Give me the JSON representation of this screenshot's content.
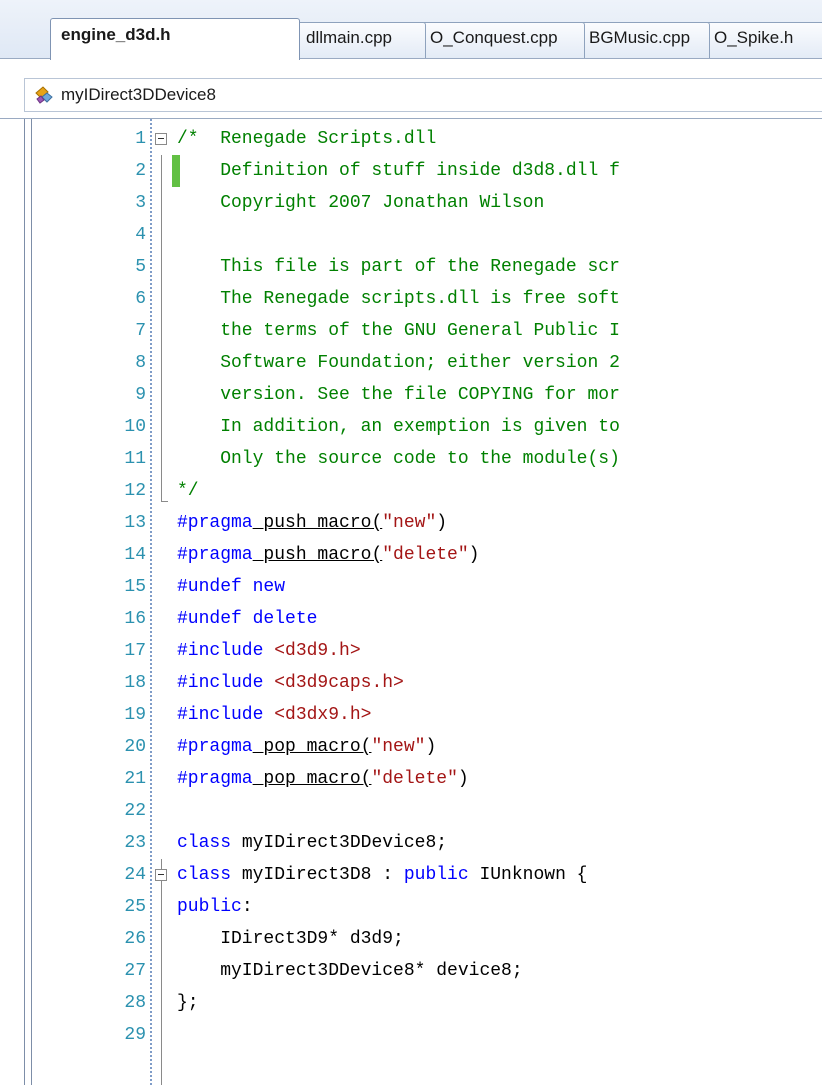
{
  "tabs": [
    {
      "label": "engine_d3d.h",
      "active": true
    },
    {
      "label": "dllmain.cpp",
      "active": false
    },
    {
      "label": "O_Conquest.cpp",
      "active": false
    },
    {
      "label": "BGMusic.cpp",
      "active": false
    },
    {
      "label": "O_Spike.h",
      "active": false
    }
  ],
  "nav": {
    "icon": "class-icon",
    "label": "myIDirect3DDevice8"
  },
  "colors": {
    "line_number": "#2b91af",
    "comment": "#008000",
    "keyword": "#0000ff",
    "string": "#a31515",
    "text": "#000000",
    "change_marker": "#62c044"
  },
  "editor": {
    "lines": [
      {
        "n": "1",
        "text": "/*  Renegade Scripts.dll"
      },
      {
        "n": "2",
        "text": "    Definition of stuff inside d3d8.dll f"
      },
      {
        "n": "3",
        "text": "    Copyright 2007 Jonathan Wilson"
      },
      {
        "n": "4",
        "text": ""
      },
      {
        "n": "5",
        "text": "    This file is part of the Renegade scr"
      },
      {
        "n": "6",
        "text": "    The Renegade scripts.dll is free soft"
      },
      {
        "n": "7",
        "text": "    the terms of the GNU General Public I"
      },
      {
        "n": "8",
        "text": "    Software Foundation; either version 2"
      },
      {
        "n": "9",
        "text": "    version. See the file COPYING for mor"
      },
      {
        "n": "10",
        "text": "    In addition, an exemption is given to"
      },
      {
        "n": "11",
        "text": "    Only the source code to the module(s)"
      },
      {
        "n": "12",
        "text": "*/"
      },
      {
        "n": "13",
        "kw": "#pragma",
        "mid": " push_macro(",
        "str": "\"new\"",
        "end": ")"
      },
      {
        "n": "14",
        "kw": "#pragma",
        "mid": " push_macro(",
        "str": "\"delete\"",
        "end": ")"
      },
      {
        "n": "15",
        "kw": "#undef",
        "kw2": " new"
      },
      {
        "n": "16",
        "kw": "#undef",
        "kw2": " delete"
      },
      {
        "n": "17",
        "kw": "#include",
        "str": " <d3d9.h>"
      },
      {
        "n": "18",
        "kw": "#include",
        "str": " <d3d9caps.h>"
      },
      {
        "n": "19",
        "kw": "#include",
        "str": " <d3dx9.h>"
      },
      {
        "n": "20",
        "kw": "#pragma",
        "mid": " pop_macro(",
        "str": "\"new\"",
        "end": ")"
      },
      {
        "n": "21",
        "kw": "#pragma",
        "mid": " pop_macro(",
        "str": "\"delete\"",
        "end": ")"
      },
      {
        "n": "22",
        "text": ""
      },
      {
        "n": "23",
        "kw": "class",
        "rest": " myIDirect3DDevice8;"
      },
      {
        "n": "24",
        "kw": "class",
        "rest": " myIDirect3D8 : ",
        "kw3": "public",
        "rest2": " IUnknown {"
      },
      {
        "n": "25",
        "kw": "public",
        "rest": ":"
      },
      {
        "n": "26",
        "rest": "    IDirect3D9* d3d9;"
      },
      {
        "n": "27",
        "rest": "    myIDirect3DDevice8* device8;"
      },
      {
        "n": "28",
        "rest": "};"
      },
      {
        "n": "29",
        "text": ""
      }
    ]
  }
}
